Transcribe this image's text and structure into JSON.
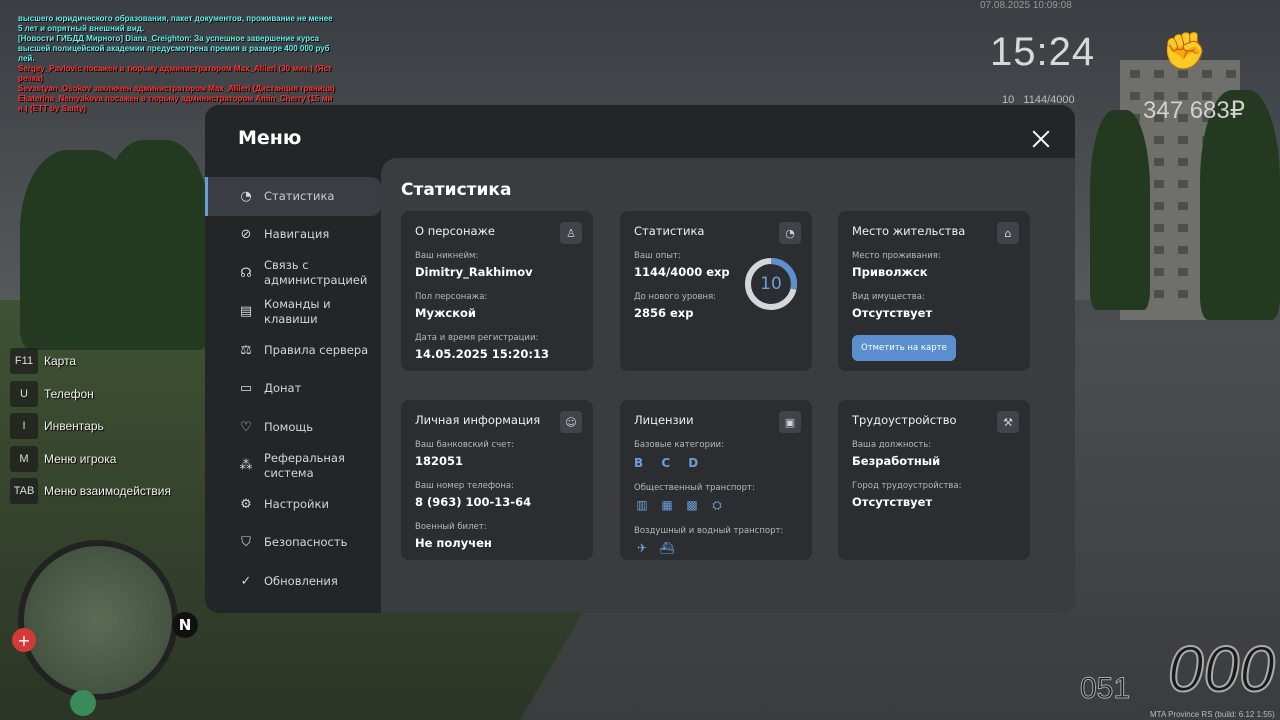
{
  "chat": [
    {
      "text": "высшего юридического образования, пакет документов, проживание не менее",
      "color": "cyan"
    },
    {
      "text": " 5 лет и опрятный внешний вид.",
      "color": "cyan"
    },
    {
      "text": "[Новости ГИБДД Мирного] Diana_Creighton: За успешное завершение курса",
      "color": "cyan"
    },
    {
      "text": " высшей полицейской академии предусмотрена премия в размере 400 000 руб",
      "color": "cyan"
    },
    {
      "text": "лей.",
      "color": "cyan"
    },
    {
      "text": "Sergey_Pavlovic посажен в тюрьму администратором Max_Allieri (30 мин.) (Яст",
      "color": "red"
    },
    {
      "text": "речка)",
      "color": "red"
    },
    {
      "text": "Sevastyan_Osokov заключен администратором Max_Allieri (Дистанция граница)",
      "color": "red"
    },
    {
      "text": "Ekaterina_Nemyakova посажен в тюрьму администратором Amin_Cherry (15 ми",
      "color": "red"
    },
    {
      "text": "н.) (ETT by Santy)",
      "color": "red"
    }
  ],
  "hud": {
    "date": "07.08.2025 10:09:08",
    "time": "15:24",
    "level": "10",
    "exp": "1144/4000",
    "money": "347 683₽",
    "speed": "000",
    "fuel": "051",
    "build": "MTA Province RS (build: 6.12 1:55)"
  },
  "hotkeys": [
    {
      "key": "F11",
      "label": "Карта"
    },
    {
      "key": "U",
      "label": "Телефон"
    },
    {
      "key": "I",
      "label": "Инвентарь"
    },
    {
      "key": "M",
      "label": "Меню игрока"
    },
    {
      "key": "TAB",
      "label": "Меню взаимодействия"
    }
  ],
  "minimap": {
    "north": "N"
  },
  "menu": {
    "title": "Меню",
    "sidebar": [
      {
        "label": "Статистика",
        "icon": "chart-pie-icon"
      },
      {
        "label": "Навигация",
        "icon": "compass-icon"
      },
      {
        "label": "Связь с администрацией",
        "icon": "headset-icon"
      },
      {
        "label": "Команды и клавиши",
        "icon": "document-icon"
      },
      {
        "label": "Правила сервера",
        "icon": "scales-icon"
      },
      {
        "label": "Донат",
        "icon": "wallet-icon"
      },
      {
        "label": "Помощь",
        "icon": "heart-hand-icon"
      },
      {
        "label": "Реферальная система",
        "icon": "network-icon"
      },
      {
        "label": "Настройки",
        "icon": "gear-icon"
      },
      {
        "label": "Безопасность",
        "icon": "shield-icon"
      },
      {
        "label": "Обновления",
        "icon": "refresh-check-icon"
      }
    ],
    "content_title": "Статистика",
    "cards": {
      "character": {
        "title": "О персонаже",
        "nick_label": "Ваш никнейм:",
        "nick": "Dimitry_Rakhimov",
        "gender_label": "Пол персонажа:",
        "gender": "Мужской",
        "reg_label": "Дата и время регистрации:",
        "reg": "14.05.2025 15:20:13"
      },
      "stats": {
        "title": "Статистика",
        "exp_label": "Ваш опыт:",
        "exp": "1144/4000 exp",
        "next_label": "До нового уровня:",
        "next": "2856 exp",
        "level": "10",
        "progress": 0.286
      },
      "residence": {
        "title": "Место жительства",
        "place_label": "Место проживания:",
        "place": "Приволжск",
        "prop_label": "Вид имущества:",
        "prop": "Отсутствует",
        "button": "Отметить на карте"
      },
      "personal": {
        "title": "Личная информация",
        "bank_label": "Ваш банковский счет:",
        "bank": "182051",
        "phone_label": "Ваш номер телефона:",
        "phone": "8 (963) 100-13-64",
        "military_label": "Военный билет:",
        "military": "Не получен"
      },
      "licenses": {
        "title": "Лицензии",
        "basic_label": "Базовые категории:",
        "basic": "B C D",
        "public_label": "Общественный транспорт:",
        "air_label": "Воздушный и водный транспорт:"
      },
      "job": {
        "title": "Трудоустройство",
        "position_label": "Ваша должность:",
        "position": "Безработный",
        "city_label": "Город трудоустройства:",
        "city": "Отсутствует"
      }
    }
  }
}
